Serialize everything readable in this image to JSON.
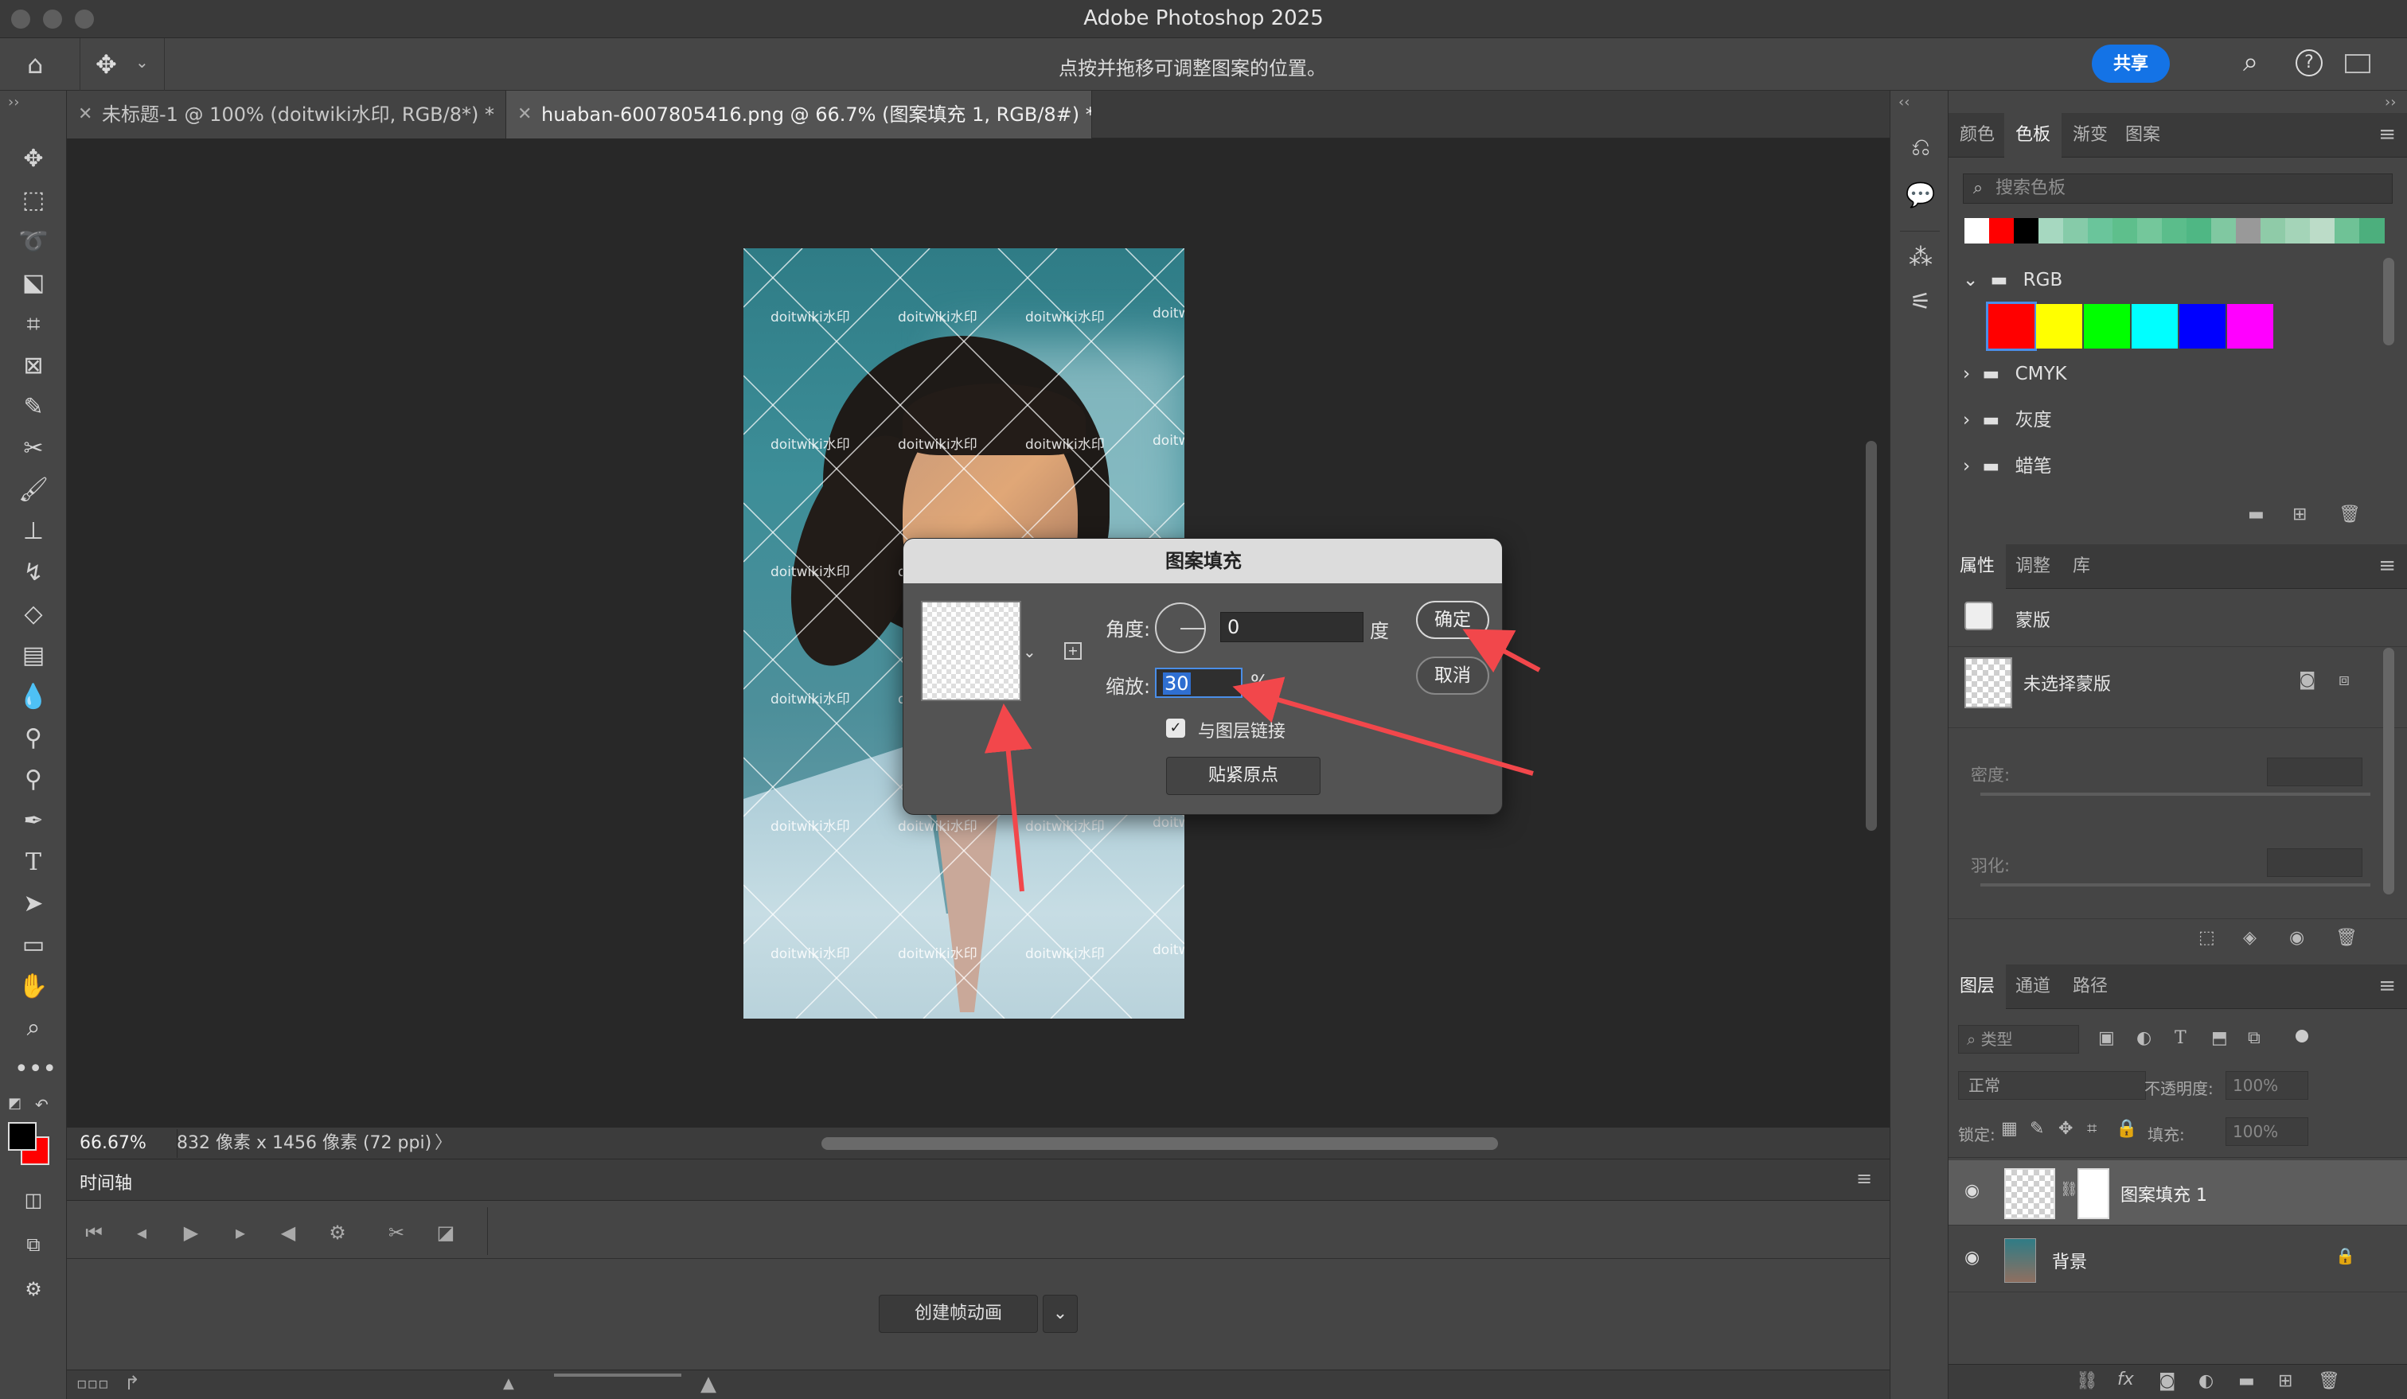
{
  "app": {
    "title": "Adobe Photoshop 2025"
  },
  "options_bar": {
    "hint": "点按并拖移可调整图案的位置。",
    "share_label": "共享"
  },
  "doc_tabs": [
    {
      "label": "未标题-1 @ 100% (doitwiki水印, RGB/8*) *",
      "active": false
    },
    {
      "label": "huaban-6007805416.png @ 66.7% (图案填充 1, RGB/8#) *",
      "active": true
    }
  ],
  "canvas": {
    "watermark": "doitwiki水印",
    "watermark_cut": "doitw"
  },
  "status": {
    "zoom": "66.67%",
    "size": "832 像素 x 1456 像素 (72 ppi)",
    "arrow": "〉"
  },
  "timeline": {
    "title": "时间轴",
    "create_label": "创建帧动画",
    "dropdown_glyph": "⌄"
  },
  "dialog": {
    "title": "图案填充",
    "angle_label": "角度:",
    "angle_value": "0",
    "angle_unit": "度",
    "scale_label": "缩放:",
    "scale_value": "30",
    "scale_unit": "%",
    "link_label": "与图层链接",
    "link_checked": true,
    "snap_label": "贴紧原点",
    "ok_label": "确定",
    "cancel_label": "取消"
  },
  "swatches_panel": {
    "tabs": [
      "颜色",
      "色板",
      "渐变",
      "图案"
    ],
    "active_tab": "色板",
    "search_placeholder": "搜索色板",
    "recent_colors": [
      "#ffffff",
      "#ff0000",
      "#000000",
      "#a6d8c0",
      "#86cba9",
      "#6ac59b",
      "#5ebf8c",
      "#74c79b",
      "#5bbd8b",
      "#4fb784",
      "#80c8a1",
      "#999999",
      "#8fcba8",
      "#a4d4b8",
      "#bcdcc8",
      "#6fc296",
      "#4caf7d"
    ],
    "groups": [
      {
        "name": "RGB",
        "expanded": true,
        "colors": [
          "#ff0000",
          "#ffff00",
          "#00ff00",
          "#00ffff",
          "#0000ff",
          "#ff00ff"
        ]
      },
      {
        "name": "CMYK",
        "expanded": false
      },
      {
        "name": "灰度",
        "expanded": false
      },
      {
        "name": "蜡笔",
        "expanded": false
      }
    ]
  },
  "properties_panel": {
    "tabs": [
      "属性",
      "调整",
      "库"
    ],
    "active_tab": "属性",
    "mask_label": "蒙版",
    "no_mask_label": "未选择蒙版",
    "density_label": "密度:",
    "feather_label": "羽化:"
  },
  "layers_panel": {
    "tabs": [
      "图层",
      "通道",
      "路径"
    ],
    "active_tab": "图层",
    "filter_label": "类型",
    "blend_mode": "正常",
    "opacity_label": "不透明度:",
    "opacity_value": "100%",
    "lock_label": "锁定:",
    "fill_label": "填充:",
    "fill_value": "100%",
    "layers": [
      {
        "name": "图案填充 1",
        "visible": true,
        "selected": true,
        "locked": false
      },
      {
        "name": "背景",
        "visible": true,
        "selected": false,
        "locked": true
      }
    ]
  }
}
